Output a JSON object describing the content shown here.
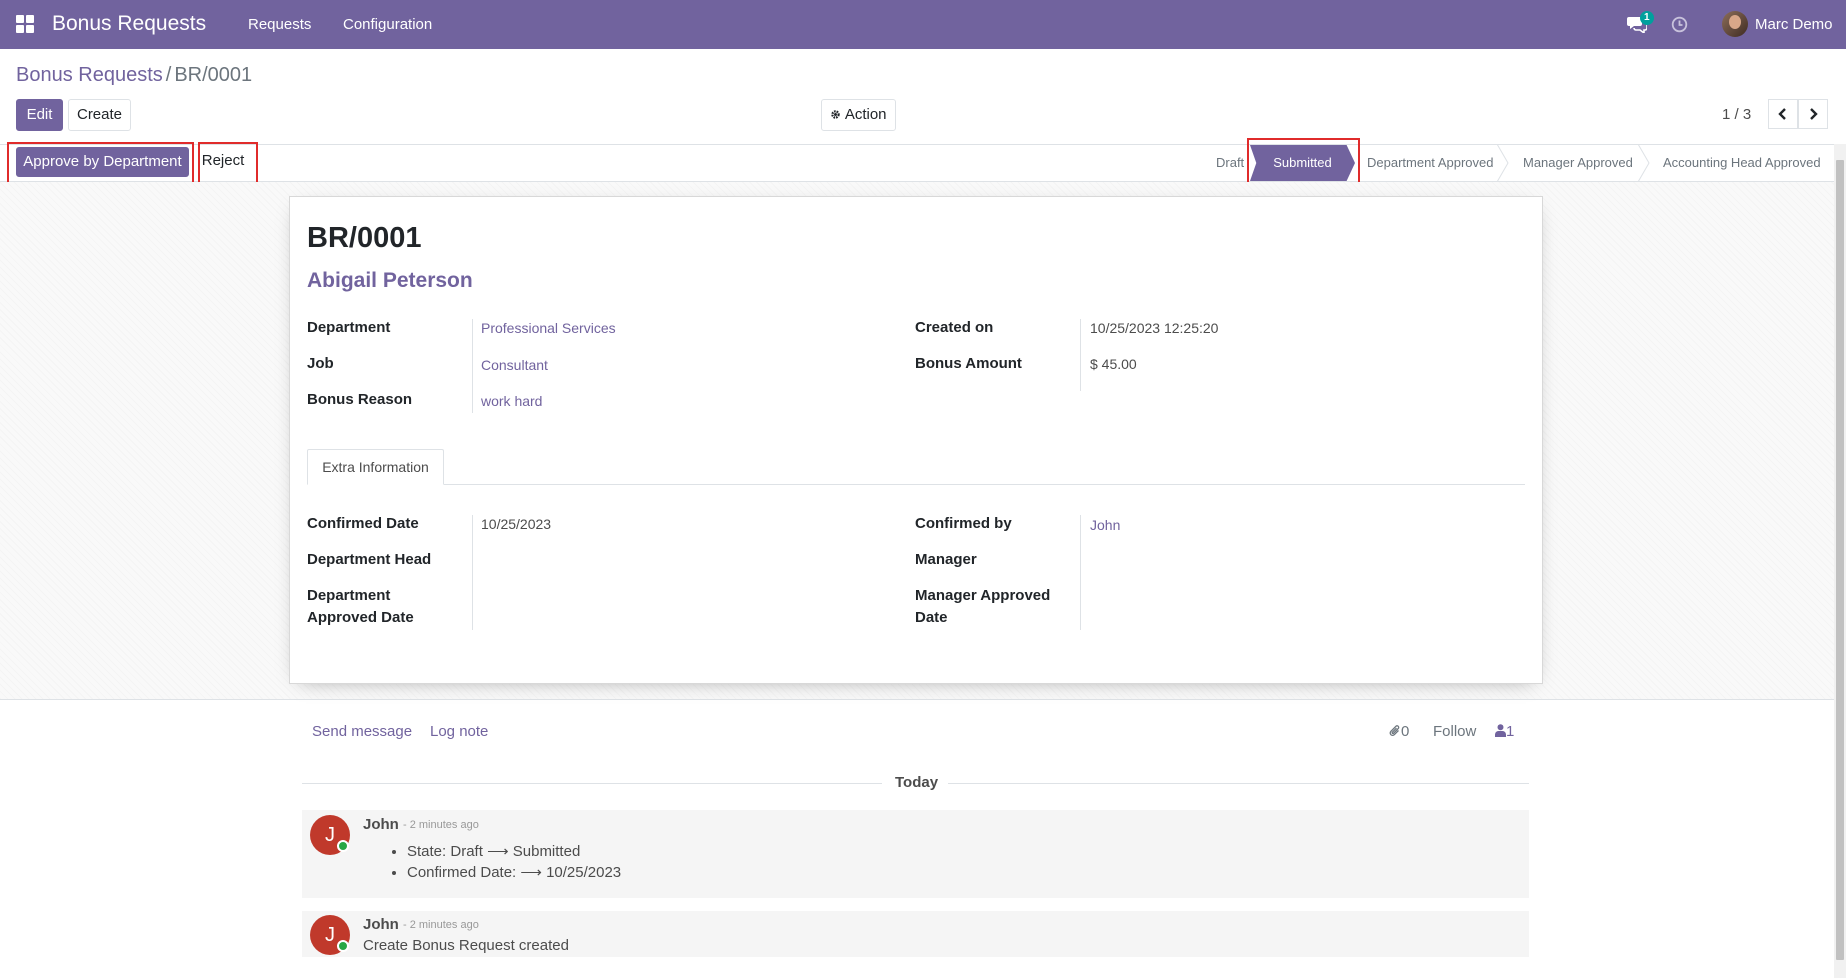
{
  "navbar": {
    "app_title": "Bonus Requests",
    "menu": [
      "Requests",
      "Configuration"
    ],
    "chat_badge": "1",
    "user_name": "Marc Demo",
    "icons": [
      "apps-grid-icon",
      "chat-icon",
      "clock-icon"
    ]
  },
  "breadcrumb": {
    "parent": "Bonus Requests",
    "separator": "/",
    "current": "BR/0001"
  },
  "buttons": {
    "edit": "Edit",
    "create": "Create",
    "action": "Action"
  },
  "pager": {
    "value": "1 / 3"
  },
  "header_buttons": {
    "approve": "Approve by Department",
    "reject": "Reject"
  },
  "statusbar": {
    "stages": [
      "Draft",
      "Submitted",
      "Department Approved",
      "Manager Approved",
      "Accounting Head Approved"
    ],
    "active": "Submitted"
  },
  "record": {
    "name": "BR/0001",
    "employee": "Abigail Peterson",
    "fields_left": [
      {
        "label": "Department",
        "value": "Professional Services"
      },
      {
        "label": "Job",
        "value": "Consultant"
      },
      {
        "label": "Bonus Reason",
        "value": "work hard"
      }
    ],
    "fields_right": [
      {
        "label": "Created on",
        "value": "10/25/2023 12:25:20"
      },
      {
        "label": "Bonus Amount",
        "value": "$ 45.00"
      }
    ]
  },
  "tabs": {
    "extra": "Extra Information"
  },
  "extra": {
    "left": [
      {
        "label": "Confirmed Date",
        "value": "10/25/2023"
      },
      {
        "label": "Department Head",
        "value": ""
      },
      {
        "label": "Department Approved Date",
        "value": ""
      }
    ],
    "right": [
      {
        "label": "Confirmed by",
        "value": "John"
      },
      {
        "label": "Manager",
        "value": ""
      },
      {
        "label": "Manager Approved Date",
        "value": ""
      }
    ]
  },
  "chatter": {
    "send_message": "Send message",
    "log_note": "Log note",
    "attachments": "0",
    "follow": "Follow",
    "followers": "1",
    "today": "Today",
    "messages": [
      {
        "initial": "J",
        "author": "John",
        "date": "- 2 minutes ago",
        "tracking": [
          {
            "field": "State:",
            "old": "Draft",
            "new": "Submitted"
          },
          {
            "field": "Confirmed Date:",
            "old": "",
            "new": "10/25/2023"
          }
        ]
      },
      {
        "initial": "J",
        "author": "John",
        "date": "- 2 minutes ago",
        "body": "Create Bonus Request created"
      }
    ]
  },
  "colors": {
    "brand": "#71639e",
    "highlight": "#e02b2b",
    "avatar": "#c0392b"
  }
}
